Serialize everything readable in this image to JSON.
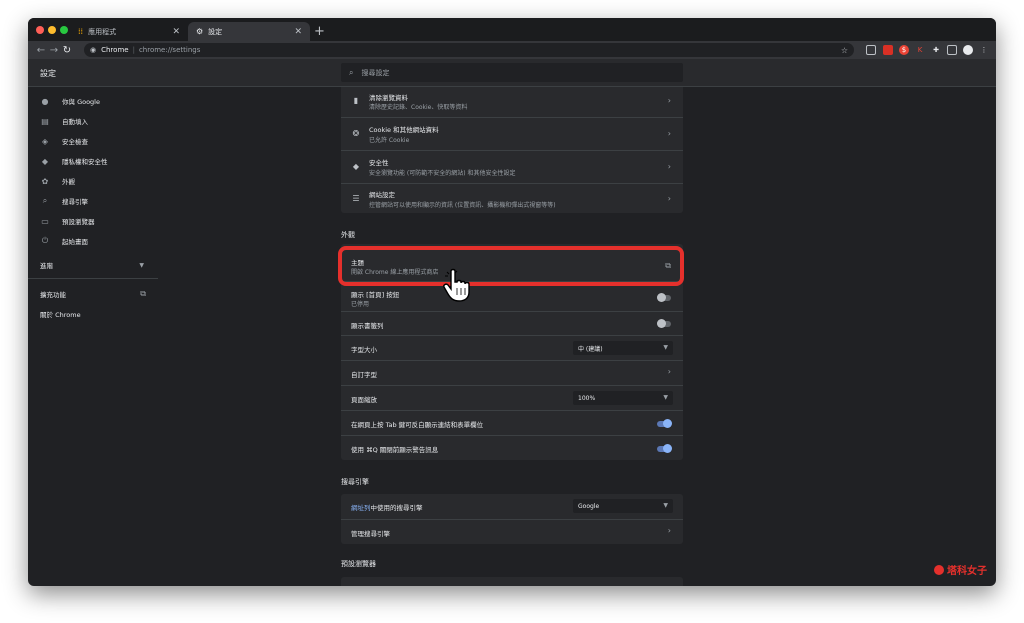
{
  "tabs": [
    {
      "label": "應用程式",
      "icon": "apps-grid-icon",
      "active": false
    },
    {
      "label": "設定",
      "icon": "gear-icon",
      "active": true
    }
  ],
  "omnibox": {
    "host": "Chrome",
    "path": "chrome://settings"
  },
  "header": {
    "title": "設定",
    "search_placeholder": "搜尋設定"
  },
  "sidebar": {
    "items": [
      {
        "label": "你與 Google",
        "icon": "person-icon"
      },
      {
        "label": "自動填入",
        "icon": "clipboard-icon"
      },
      {
        "label": "安全檢查",
        "icon": "shield-check-icon"
      },
      {
        "label": "隱私權和安全性",
        "icon": "shield-icon"
      },
      {
        "label": "外觀",
        "icon": "palette-icon"
      },
      {
        "label": "搜尋引擎",
        "icon": "search-icon"
      },
      {
        "label": "預設瀏覽器",
        "icon": "browser-icon"
      },
      {
        "label": "起始畫面",
        "icon": "power-icon"
      }
    ],
    "advanced": "進階",
    "extensions": "擴充功能",
    "about": "關於 Chrome"
  },
  "privacy": {
    "rows": [
      {
        "title": "清除瀏覽資料",
        "sub": "清除歷史記錄、Cookie、快取等資料",
        "icon": "trash-icon"
      },
      {
        "title": "Cookie 和其他網站資料",
        "sub": "已允許 Cookie",
        "icon": "cookie-icon"
      },
      {
        "title": "安全性",
        "sub": "安全瀏覽功能 (可防範不安全的網站) 和其他安全性設定",
        "icon": "shield-icon"
      },
      {
        "title": "網站設定",
        "sub": "控管網站可以使用和顯示的資訊 (位置資訊、攝影機和彈出式視窗等等)",
        "icon": "sliders-icon"
      }
    ]
  },
  "appearance": {
    "heading": "外觀",
    "theme_title": "主題",
    "theme_sub": "開啟 Chrome 線上應用程式商店",
    "home_title": "顯示 [首頁] 按鈕",
    "home_sub": "已停用",
    "bookmarks_title": "顯示書籤列",
    "font_size_title": "字型大小",
    "font_size_value": "中 (建議)",
    "custom_fonts_title": "自訂字型",
    "zoom_title": "頁面縮放",
    "zoom_value": "100%",
    "tab_title": "在網頁上按 Tab 鍵可反白顯示連結和表單欄位",
    "quit_title": "使用 ⌘Q 關閉前顯示警告訊息"
  },
  "search_engine": {
    "heading": "搜尋引擎",
    "row1_link": "網址列",
    "row1_rest": "中使用的搜尋引擎",
    "row1_value": "Google",
    "row2_title": "管理搜尋引擎"
  },
  "default_browser": {
    "heading": "預設瀏覽器"
  },
  "watermark": "塔科女子",
  "colors": {
    "accent_toggle": "#8ab4f8",
    "highlight": "#e5302c",
    "link": "#8ab4f8"
  }
}
